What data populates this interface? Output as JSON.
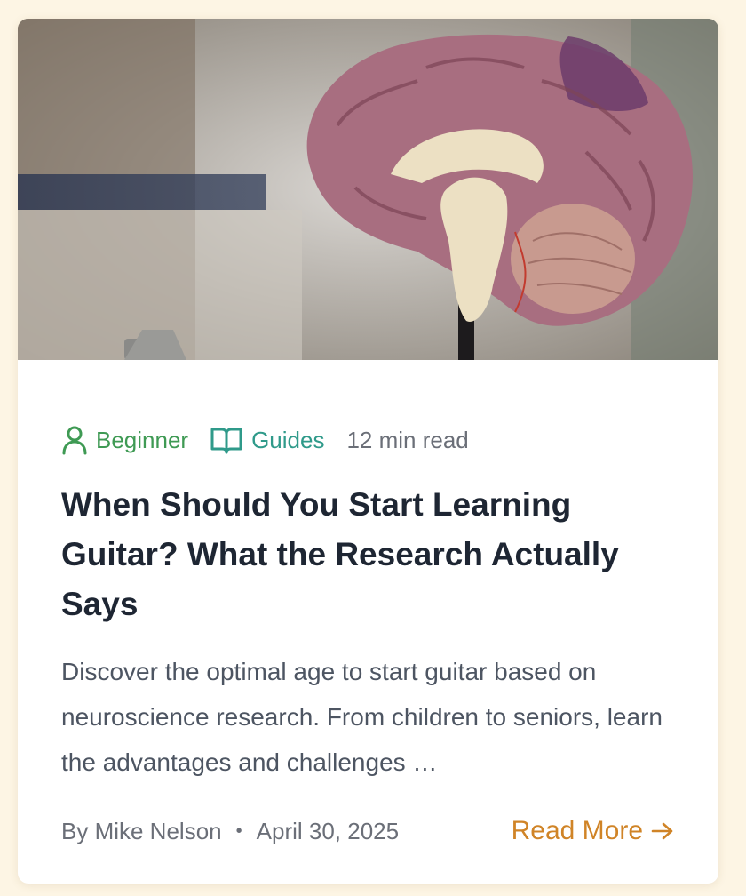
{
  "card": {
    "image_alt": "Brain model",
    "tags": {
      "level_label": "Beginner",
      "level_icon": "user-icon",
      "category_label": "Guides",
      "category_icon": "book-open-icon",
      "read_time": "12 min read"
    },
    "title": "When Should You Start Learning Guitar? What the Research Actually Says",
    "excerpt": "Discover the optimal age to start guitar based on neuroscience research. From children to seniors, learn the advantages and challenges …",
    "author": "By Mike Nelson",
    "separator": "•",
    "date": "April 30, 2025",
    "read_more_label": "Read More",
    "read_more_icon": "arrow-right-icon"
  },
  "colors": {
    "page_bg": "#fdf5e4",
    "level_green": "#3f9a54",
    "category_teal": "#2f9a8a",
    "title": "#1e2633",
    "accent_orange": "#d08427"
  }
}
